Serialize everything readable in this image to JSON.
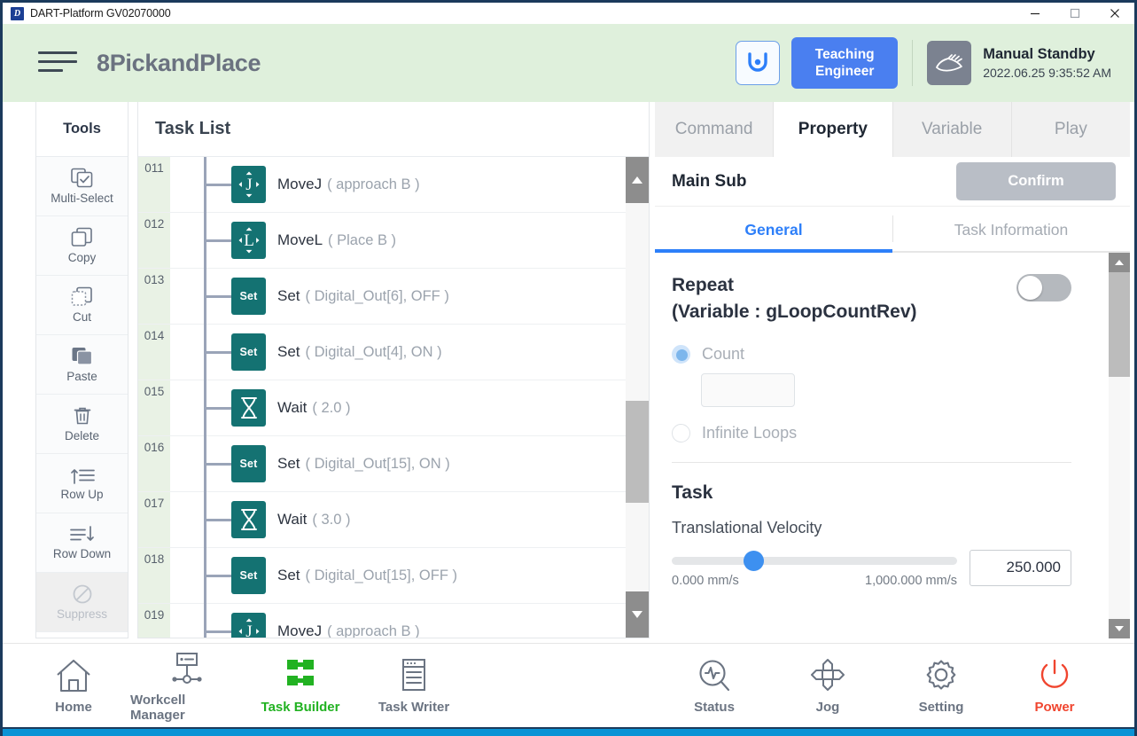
{
  "window": {
    "app_icon": "dart-logo-icon",
    "title": "DART-Platform GV02070000",
    "minimize": "minimize-icon",
    "maximize": "maximize-icon",
    "close": "close-icon"
  },
  "header": {
    "menu_icon": "hamburger-menu-icon",
    "project_title": "8PickandPlace",
    "robot_icon": "robot-arm-icon",
    "teaching_line1": "Teaching",
    "teaching_line2": "Engineer",
    "mode_icon": "manual-hand-icon",
    "mode_status": "Manual Standby",
    "mode_timestamp": "2022.06.25 9:35:52 AM"
  },
  "tools": {
    "heading": "Tools",
    "items": [
      {
        "label": "Multi-Select",
        "icon": "multi-select-icon",
        "disabled": false
      },
      {
        "label": "Copy",
        "icon": "copy-icon",
        "disabled": false
      },
      {
        "label": "Cut",
        "icon": "cut-icon",
        "disabled": false
      },
      {
        "label": "Paste",
        "icon": "paste-icon",
        "disabled": false
      },
      {
        "label": "Delete",
        "icon": "trash-icon",
        "disabled": false
      },
      {
        "label": "Row Up",
        "icon": "row-up-icon",
        "disabled": false
      },
      {
        "label": "Row Down",
        "icon": "row-down-icon",
        "disabled": false
      },
      {
        "label": "Suppress",
        "icon": "suppress-icon",
        "disabled": true
      }
    ]
  },
  "task_list": {
    "heading": "Task List",
    "rows": [
      {
        "num": "011",
        "icon": "movej-icon",
        "icon_label": "J",
        "command": "MoveJ",
        "args": "( approach B )"
      },
      {
        "num": "012",
        "icon": "movel-icon",
        "icon_label": "L",
        "command": "MoveL",
        "args": "( Place B )"
      },
      {
        "num": "013",
        "icon": "set-icon",
        "icon_label": "Set",
        "command": "Set",
        "args": "( Digital_Out[6], OFF )"
      },
      {
        "num": "014",
        "icon": "set-icon",
        "icon_label": "Set",
        "command": "Set",
        "args": "( Digital_Out[4], ON )"
      },
      {
        "num": "015",
        "icon": "wait-icon",
        "icon_label": "",
        "command": "Wait",
        "args": "( 2.0 )"
      },
      {
        "num": "016",
        "icon": "set-icon",
        "icon_label": "Set",
        "command": "Set",
        "args": "( Digital_Out[15], ON )"
      },
      {
        "num": "017",
        "icon": "wait-icon",
        "icon_label": "",
        "command": "Wait",
        "args": "( 3.0 )"
      },
      {
        "num": "018",
        "icon": "set-icon",
        "icon_label": "Set",
        "command": "Set",
        "args": "( Digital_Out[15], OFF )"
      },
      {
        "num": "019",
        "icon": "movej-icon",
        "icon_label": "J",
        "command": "MoveJ",
        "args": "( approach B )"
      }
    ],
    "scroll_up_icon": "scroll-up-arrow-icon",
    "scroll_down_icon": "scroll-down-arrow-icon"
  },
  "property": {
    "tabs": [
      {
        "label": "Command",
        "active": false
      },
      {
        "label": "Property",
        "active": true
      },
      {
        "label": "Variable",
        "active": false
      },
      {
        "label": "Play",
        "active": false
      }
    ],
    "subtitle": "Main Sub",
    "confirm_label": "Confirm",
    "subtabs": [
      {
        "label": "General",
        "active": true
      },
      {
        "label": "Task Information",
        "active": false
      }
    ],
    "repeat": {
      "title_line1": "Repeat",
      "title_line2": "(Variable : gLoopCountRev)",
      "toggle_on": false,
      "count_label": "Count",
      "count_value": "",
      "count_selected": true,
      "infinite_label": "Infinite Loops",
      "infinite_selected": false
    },
    "task": {
      "section_title": "Task",
      "velocity_label": "Translational Velocity",
      "velocity_min": "0.000 mm/s",
      "velocity_max": "1,000.000 mm/s",
      "velocity_value": "250.000",
      "velocity_percent": 25
    },
    "scroll_up_icon": "scroll-up-arrow-icon",
    "scroll_down_icon": "scroll-down-arrow-icon"
  },
  "bottom_nav": {
    "left": [
      {
        "label": "Home",
        "icon": "home-icon",
        "active": false
      },
      {
        "label": "Workcell Manager",
        "icon": "workcell-icon",
        "active": false
      },
      {
        "label": "Task Builder",
        "icon": "task-builder-icon",
        "active": true
      },
      {
        "label": "Task Writer",
        "icon": "task-writer-icon",
        "active": false
      }
    ],
    "right": [
      {
        "label": "Status",
        "icon": "status-icon",
        "active": false
      },
      {
        "label": "Jog",
        "icon": "jog-icon",
        "active": false
      },
      {
        "label": "Setting",
        "icon": "gear-icon",
        "active": false
      },
      {
        "label": "Power",
        "icon": "power-icon",
        "active": false,
        "danger": true
      }
    ]
  },
  "colors": {
    "header_green": "#dff0dc",
    "accent_blue": "#2d7ff9",
    "command_teal": "#147272",
    "active_green": "#22b222",
    "power_red": "#f0452f",
    "bottom_bar": "#0b93d5"
  }
}
